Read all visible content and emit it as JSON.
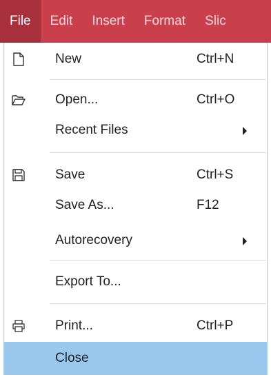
{
  "menubar": {
    "items": [
      "File",
      "Edit",
      "Insert",
      "Format",
      "Slic"
    ]
  },
  "menu": {
    "new": {
      "label": "New",
      "shortcut": "Ctrl+N",
      "icon": "file-icon"
    },
    "open": {
      "label": "Open...",
      "shortcut": "Ctrl+O",
      "icon": "folder-open-icon"
    },
    "recent": {
      "label": "Recent Files",
      "submenu": true
    },
    "save": {
      "label": "Save",
      "shortcut": "Ctrl+S",
      "icon": "floppy-disk-icon"
    },
    "save_as": {
      "label": "Save As...",
      "shortcut": "F12"
    },
    "autorecovery": {
      "label": "Autorecovery",
      "submenu": true
    },
    "export": {
      "label": "Export To..."
    },
    "print": {
      "label": "Print...",
      "shortcut": "Ctrl+P",
      "icon": "printer-icon"
    },
    "close": {
      "label": "Close",
      "highlighted": true
    }
  },
  "colors": {
    "menubar_bg": "#c9404c",
    "active_menu_bg": "#a8303c",
    "highlight": "#99c8ef"
  }
}
